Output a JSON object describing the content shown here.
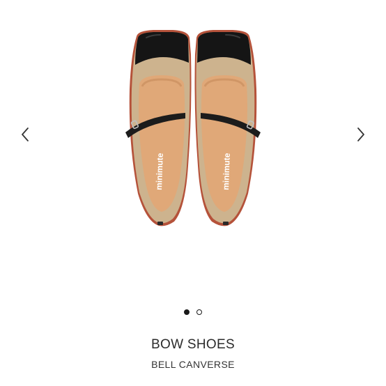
{
  "product": {
    "name": "BOW SHOES",
    "brand": "BELL CANVERSE",
    "insole_text": "minimute"
  },
  "carousel": {
    "current_slide": 1,
    "slide_count": 2,
    "prev_icon": "chevron-left-icon",
    "next_icon": "chevron-right-icon"
  },
  "colors": {
    "background": "#ffffff",
    "shoe_upper": "#cdb38e",
    "insole": "#e0a878",
    "toe_cap": "#151515",
    "strap": "#1c1c1c",
    "sole_edge": "#b5523a"
  }
}
